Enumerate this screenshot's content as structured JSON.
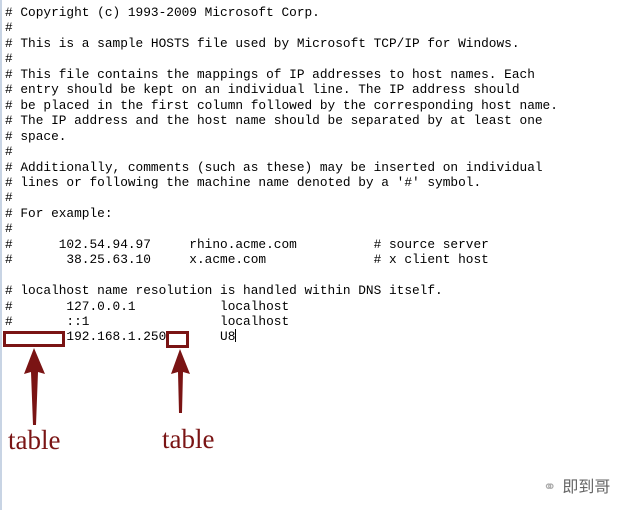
{
  "editor": {
    "lines": [
      "# Copyright (c) 1993-2009 Microsoft Corp.",
      "#",
      "# This is a sample HOSTS file used by Microsoft TCP/IP for Windows.",
      "#",
      "# This file contains the mappings of IP addresses to host names. Each",
      "# entry should be kept on an individual line. The IP address should",
      "# be placed in the first column followed by the corresponding host name.",
      "# The IP address and the host name should be separated by at least one",
      "# space.",
      "#",
      "# Additionally, comments (such as these) may be inserted on individual",
      "# lines or following the machine name denoted by a '#' symbol.",
      "#",
      "# For example:",
      "#",
      "#      102.54.94.97     rhino.acme.com          # source server",
      "#       38.25.63.10     x.acme.com              # x client host",
      "",
      "# localhost name resolution is handled within DNS itself.",
      "#       127.0.0.1           localhost",
      "#       ::1                 localhost",
      "        192.168.1.250       U8"
    ]
  },
  "annotations": {
    "left_label": "table",
    "right_label": "table",
    "color": "#7a1414"
  },
  "watermark": {
    "icon": "wechat-icon",
    "text": "即到哥"
  }
}
